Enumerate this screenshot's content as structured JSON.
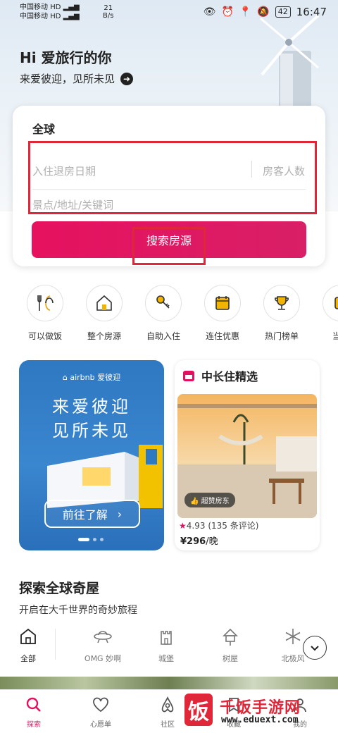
{
  "status_bar": {
    "carrier1": "中国移动",
    "carrier1_badge": "HD",
    "carrier2": "中国移动",
    "carrier2_badge": "HD",
    "net_speed_value": "21",
    "net_speed_unit": "B/s",
    "battery": "42",
    "time": "16:47"
  },
  "header": {
    "greeting": "Hi 爱旅行的你",
    "subtitle": "来爱彼迎，见所未见"
  },
  "search_card": {
    "region": "全球",
    "date_placeholder": "入住退房日期",
    "guests_placeholder": "房客人数",
    "keyword_placeholder": "景点/地址/关键词",
    "search_button": "搜索房源"
  },
  "categories": [
    {
      "label": "可以做饭",
      "icon": "cutlery-icon"
    },
    {
      "label": "整个房源",
      "icon": "house-icon"
    },
    {
      "label": "自助入住",
      "icon": "key-icon"
    },
    {
      "label": "连住优惠",
      "icon": "calendar-icon"
    },
    {
      "label": "热门榜单",
      "icon": "trophy-icon"
    },
    {
      "label": "当地",
      "icon": "local-icon"
    }
  ],
  "promo": {
    "brand": "airbnb 爱彼迎",
    "line1": "来爱彼迎",
    "line2": "见所未见",
    "button": "前往了解"
  },
  "long_stay": {
    "title": "中长住精选",
    "badge": "超赞房东",
    "rating": "4.93",
    "reviews": "(135 条评论)",
    "price": "¥296",
    "price_unit": "/晚"
  },
  "explore": {
    "title": "探索全球奇屋",
    "subtitle": "开启在大千世界的奇妙旅程",
    "tabs": [
      {
        "label": "全部",
        "icon": "house-outline-icon",
        "active": true
      },
      {
        "label": "OMG 妙啊",
        "icon": "ufo-icon"
      },
      {
        "label": "城堡",
        "icon": "castle-icon"
      },
      {
        "label": "树屋",
        "icon": "treehouse-icon"
      },
      {
        "label": "北极风",
        "icon": "snowflake-icon"
      }
    ]
  },
  "bottom_nav": [
    {
      "label": "探索",
      "icon": "search-icon",
      "active": true
    },
    {
      "label": "心愿单",
      "icon": "heart-icon"
    },
    {
      "label": "社区",
      "icon": "airbnb-logo-icon"
    },
    {
      "label": "收藏",
      "icon": "bookmark-icon"
    },
    {
      "label": "我的",
      "icon": "profile-icon"
    }
  ],
  "watermark": {
    "badge": "饭",
    "name": "千饭手游网",
    "url": "www.eduext.com"
  },
  "colors": {
    "accent": "#E0115F",
    "annotation_red": "#E0273A",
    "promo_blue": "#2F78C2"
  }
}
